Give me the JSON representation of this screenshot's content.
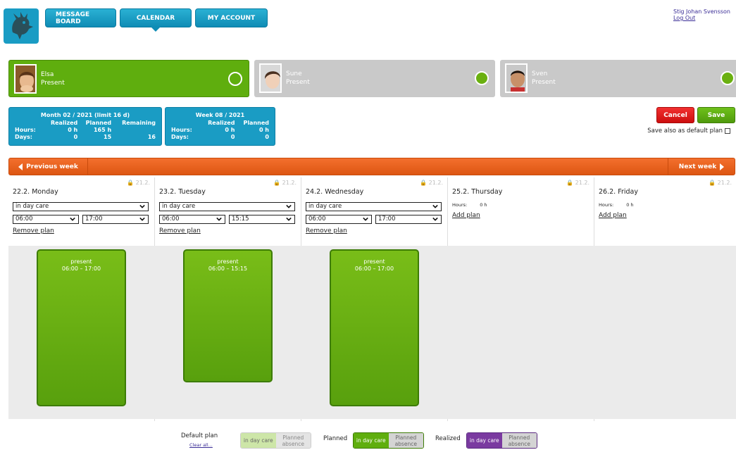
{
  "header": {
    "nav": [
      {
        "label": "MESSAGE BOARD",
        "active": false
      },
      {
        "label": "CALENDAR",
        "active": true
      },
      {
        "label": "MY ACCOUNT",
        "active": false
      }
    ],
    "user_name": "Stig Johan Svensson",
    "logout": "Log Out"
  },
  "children": [
    {
      "name": "Elsa",
      "status": "Present",
      "active": true
    },
    {
      "name": "Sune",
      "status": "Present",
      "active": false
    },
    {
      "name": "Sven",
      "status": "Present",
      "active": false
    }
  ],
  "month_stats": {
    "title": "Month 02 / 2021 (limit 16 d)",
    "col_realized": "Realized",
    "col_planned": "Planned",
    "col_remaining": "Remaining",
    "row_hours": "Hours:",
    "row_days": "Days:",
    "hours_realized": "0 h",
    "hours_planned": "165 h",
    "days_realized": "0",
    "days_planned": "15",
    "days_remaining": "16"
  },
  "week_stats": {
    "title": "Week 08 / 2021",
    "col_realized": "Realized",
    "col_planned": "Planned",
    "row_hours": "Hours:",
    "row_days": "Days:",
    "hours_realized": "0 h",
    "hours_planned": "0 h",
    "days_realized": "0",
    "days_planned": "0"
  },
  "actions": {
    "cancel": "Cancel",
    "save": "Save",
    "default_plan": "Save also as default plan"
  },
  "weekbar": {
    "prev": "Previous week",
    "next": "Next week"
  },
  "days": [
    {
      "title": "22.2. Monday",
      "lock": "21.2.",
      "care": "in day care",
      "start": "06:00",
      "end": "17:00",
      "link": "Remove plan",
      "bar_status": "present",
      "bar_time": "06:00 – 17:00"
    },
    {
      "title": "23.2. Tuesday",
      "lock": "21.2.",
      "care": "in day care",
      "start": "06:00",
      "end": "15:15",
      "link": "Remove plan",
      "bar_status": "present",
      "bar_time": "06:00 – 15:15"
    },
    {
      "title": "24.2. Wednesday",
      "lock": "21.2.",
      "care": "in day care",
      "start": "06:00",
      "end": "17:00",
      "link": "Remove plan",
      "bar_status": "present",
      "bar_time": "06:00 – 17:00"
    },
    {
      "title": "25.2. Thursday",
      "lock": "21.2.",
      "hours_label": "Hours:",
      "hours_value": "0 h",
      "link": "Add plan"
    },
    {
      "title": "26.2. Friday",
      "lock": "21.2.",
      "hours_label": "Hours:",
      "hours_value": "0 h",
      "link": "Add plan"
    }
  ],
  "legend": {
    "default_plan": "Default plan",
    "clear_all": "Clear all...",
    "planned": "Planned",
    "realized": "Realized",
    "in_day_care": "in day care",
    "planned_absence": "Planned absence"
  },
  "colors": {
    "primary_blue": "#1a9cc4",
    "active_green": "#5fae0e",
    "orange": "#e85f1a",
    "cancel_red": "#e01f1f",
    "realized_purple": "#7a3aa0"
  }
}
